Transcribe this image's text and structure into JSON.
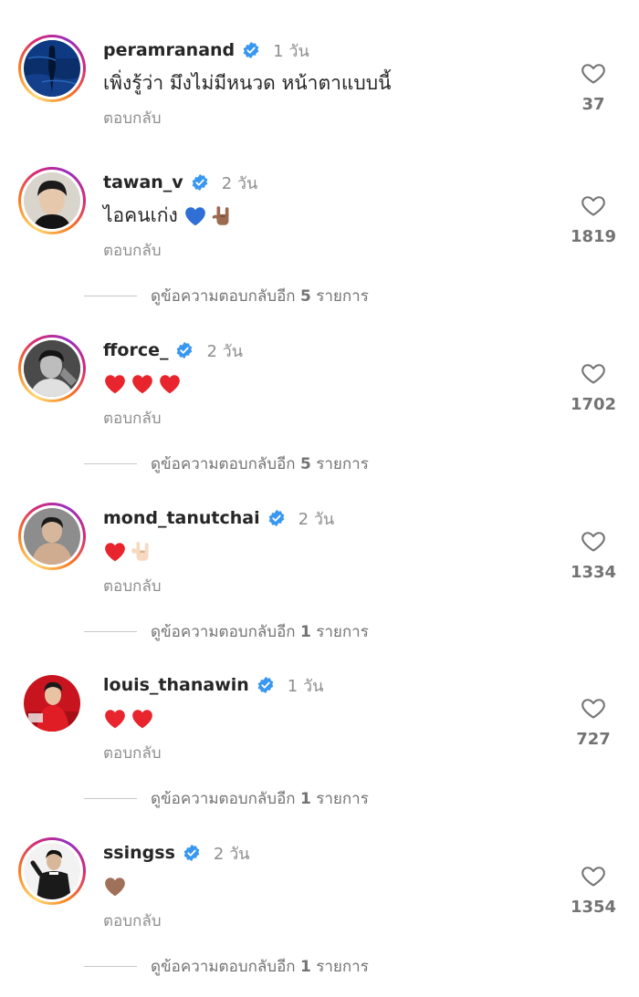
{
  "comments": [
    {
      "username": "peramranand",
      "time": "1 วัน",
      "text": "เพิ่งรู้ว่า มึงไม่มีหนวด หน้าตาแบบนี้",
      "emojis": [],
      "reply_label": "ตอบกลับ",
      "likes": "37",
      "replies_prefix": "",
      "replies_count": "",
      "replies_suffix": ""
    },
    {
      "username": "tawan_v",
      "time": "2 วัน",
      "text": "ไอคนเก่ง",
      "emojis": [
        "blue-heart-icon",
        "rock-hand-icon"
      ],
      "reply_label": "ตอบกลับ",
      "likes": "1819",
      "replies_prefix": "ดูข้อความตอบกลับอีก ",
      "replies_count": "5",
      "replies_suffix": " รายการ"
    },
    {
      "username": "fforce_",
      "time": "2 วัน",
      "text": "",
      "emojis": [
        "red-heart-icon",
        "red-heart-icon",
        "red-heart-icon"
      ],
      "reply_label": "ตอบกลับ",
      "likes": "1702",
      "replies_prefix": "ดูข้อความตอบกลับอีก ",
      "replies_count": "5",
      "replies_suffix": " รายการ"
    },
    {
      "username": "mond_tanutchai",
      "time": "2 วัน",
      "text": "",
      "emojis": [
        "red-heart-icon",
        "love-you-hand-icon"
      ],
      "reply_label": "ตอบกลับ",
      "likes": "1334",
      "replies_prefix": "ดูข้อความตอบกลับอีก ",
      "replies_count": "1",
      "replies_suffix": " รายการ"
    },
    {
      "username": "louis_thanawin",
      "time": "1 วัน",
      "text": "",
      "emojis": [
        "red-heart-icon",
        "red-heart-icon"
      ],
      "reply_label": "ตอบกลับ",
      "likes": "727",
      "replies_prefix": "ดูข้อความตอบกลับอีก ",
      "replies_count": "1",
      "replies_suffix": " รายการ"
    },
    {
      "username": "ssingss",
      "time": "2 วัน",
      "text": "",
      "emojis": [
        "brown-heart-icon"
      ],
      "reply_label": "ตอบกลับ",
      "likes": "1354",
      "replies_prefix": "ดูข้อความตอบกลับอีก ",
      "replies_count": "1",
      "replies_suffix": " รายการ"
    }
  ],
  "colors": {
    "verified": "#3897f0",
    "primary_text": "#262626",
    "secondary_text": "#8e8e8e",
    "red_heart": "#e8242d",
    "blue_heart": "#2f6fd6",
    "brown_heart": "#a0715a"
  }
}
